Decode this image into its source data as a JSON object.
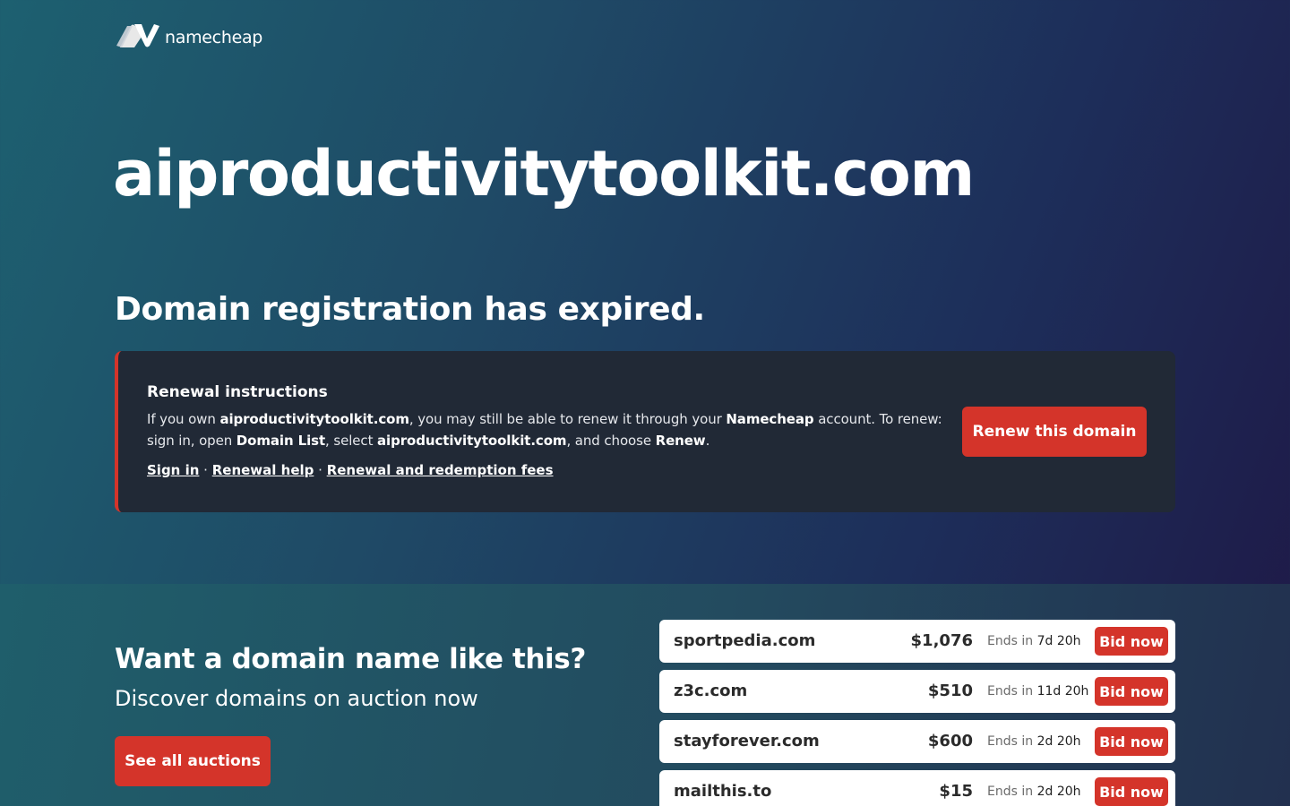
{
  "brand": {
    "logo_text": "namecheap",
    "logo_icon": "namecheap-n-icon"
  },
  "hero": {
    "domain": "aiproductivitytoolkit.com",
    "status_heading": "Domain registration has expired."
  },
  "renewal": {
    "title": "Renewal instructions",
    "body": [
      {
        "t": "If you own ",
        "b": false
      },
      {
        "t": "aiproductivitytoolkit.com",
        "b": true
      },
      {
        "t": ", you may still be able to renew it through your ",
        "b": false
      },
      {
        "t": "Namecheap",
        "b": true
      },
      {
        "t": " account. To renew: sign in, open ",
        "b": false
      },
      {
        "t": "Domain List",
        "b": true
      },
      {
        "t": ", select ",
        "b": false
      },
      {
        "t": "aiproductivitytoolkit.com",
        "b": true
      },
      {
        "t": ", and choose ",
        "b": false
      },
      {
        "t": "Renew",
        "b": true
      },
      {
        "t": ".",
        "b": false
      }
    ],
    "links": {
      "sign_in": "Sign in",
      "help": "Renewal help",
      "fees": "Renewal and redemption fees",
      "separator": " · "
    },
    "button_label": "Renew this domain"
  },
  "promo": {
    "heading": "Want a domain name like this?",
    "subheading": "Discover domains on auction now",
    "button_label": "See all auctions"
  },
  "auctions": [
    {
      "name": "sportpedia.com",
      "price": "$1,076",
      "ends_label": "Ends in",
      "ends": "7d 20h",
      "bid_label": "Bid now"
    },
    {
      "name": "z3c.com",
      "price": "$510",
      "ends_label": "Ends in",
      "ends": "11d 20h",
      "bid_label": "Bid now"
    },
    {
      "name": "stayforever.com",
      "price": "$600",
      "ends_label": "Ends in",
      "ends": "2d 20h",
      "bid_label": "Bid now"
    },
    {
      "name": "mailthis.to",
      "price": "$15",
      "ends_label": "Ends in",
      "ends": "2d 20h",
      "bid_label": "Bid now"
    }
  ],
  "colors": {
    "accent": "#d4342a",
    "card": "#212936"
  }
}
